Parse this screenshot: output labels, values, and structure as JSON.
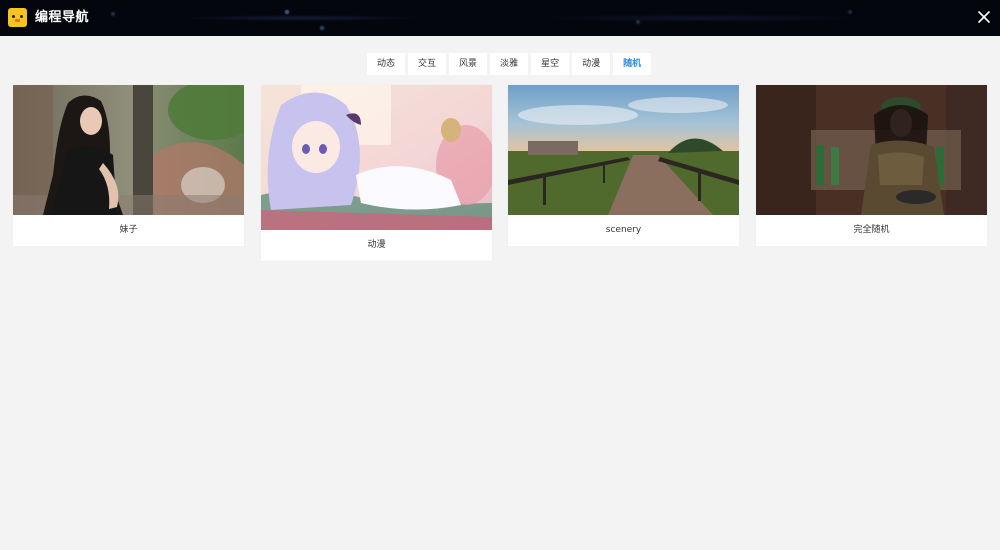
{
  "header": {
    "site_title": "编程导航",
    "logo_icon": "duck-logo-icon",
    "close_icon": "close-icon"
  },
  "tabs": [
    {
      "label": "动态",
      "active": false
    },
    {
      "label": "交互",
      "active": false
    },
    {
      "label": "风景",
      "active": false
    },
    {
      "label": "淡雅",
      "active": false
    },
    {
      "label": "星空",
      "active": false
    },
    {
      "label": "动漫",
      "active": false
    },
    {
      "label": "随机",
      "active": true
    }
  ],
  "cards": [
    {
      "caption": "妹子",
      "image": "portrait-photo"
    },
    {
      "caption": "动漫",
      "image": "anime-illustration"
    },
    {
      "caption": "scenery",
      "image": "landscape-bridge-photo"
    },
    {
      "caption": "完全随机",
      "image": "portrait-photo"
    }
  ],
  "colors": {
    "topbar": "#04060e",
    "page_background": "#f3f3f3",
    "active_tab": "#2a8fe8",
    "logo": "#f7c51d"
  }
}
